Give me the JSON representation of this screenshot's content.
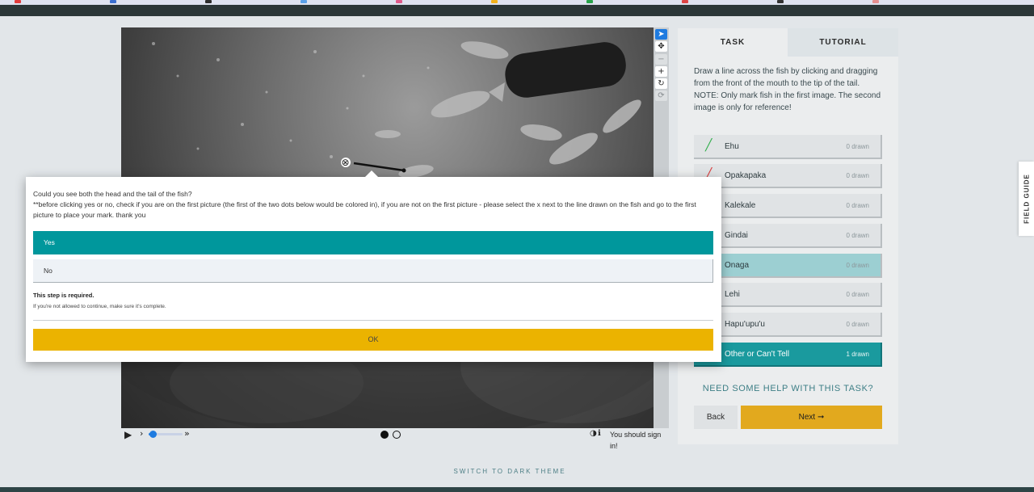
{
  "browser": {
    "favicon_colors": [
      "#e23b3b",
      "#3a6fd0",
      "#2d2d2d",
      "#5aa0e8",
      "#e05a8a",
      "#f3b21b",
      "#27a34a",
      "#d44",
      "#333",
      "#e58f8f"
    ]
  },
  "viewer": {
    "tools": [
      "pointer-icon",
      "move-icon",
      "zoom-out-icon",
      "zoom-in-icon",
      "rotate-icon",
      "reset-icon"
    ],
    "toolbar_glyphs": {
      "pointer": "➤",
      "move": "✥",
      "zoom_out": "−",
      "zoom_in": "+",
      "rotate": "↻",
      "reset": "⟳"
    },
    "delete_mark_glyph": "⊗",
    "playback": {
      "play_glyph": "▶",
      "step_back_glyph": "›",
      "step_forward_glyph": "»",
      "speed_level": 0.12,
      "frames": 2,
      "current_frame": 1
    },
    "contrast_glyph": "◑",
    "info_glyph": "ℹ",
    "signin_note": "You should sign in!"
  },
  "task_panel": {
    "tabs": [
      "TASK",
      "TUTORIAL"
    ],
    "active_tab": "TASK",
    "instructions": [
      "Draw a line across the fish by clicking and dragging from the front of the mouth to the tip of the tail.",
      "NOTE: Only mark fish in the first image. The second image is only for reference!"
    ],
    "tools": [
      {
        "label": "Ehu",
        "count": "0 drawn",
        "mark_color": "#2fae4a",
        "mark": "╱",
        "state": "normal"
      },
      {
        "label": "Opakapaka",
        "count": "0 drawn",
        "mark_color": "#d93b3b",
        "mark": "╱",
        "state": "normal"
      },
      {
        "label": "Kalekale",
        "count": "0 drawn",
        "mark_color": "",
        "mark": "",
        "state": "normal"
      },
      {
        "label": "Gindai",
        "count": "0 drawn",
        "mark_color": "",
        "mark": "",
        "state": "normal"
      },
      {
        "label": "Onaga",
        "count": "0 drawn",
        "mark_color": "",
        "mark": "",
        "state": "highlight"
      },
      {
        "label": "Lehi",
        "count": "0 drawn",
        "mark_color": "",
        "mark": "",
        "state": "normal"
      },
      {
        "label": "Hapu'upu'u",
        "count": "0 drawn",
        "mark_color": "",
        "mark": "",
        "state": "normal"
      },
      {
        "label": "Other or Can't Tell",
        "count": "1 drawn",
        "mark_color": "",
        "mark": "",
        "state": "active"
      }
    ],
    "help_link": "NEED SOME HELP WITH THIS TASK?",
    "back_label": "Back",
    "next_label": "Next ➞"
  },
  "field_guide": "FIELD GUIDE",
  "theme_toggle": "SWITCH TO DARK THEME",
  "modal": {
    "question_line1": "Could you see both the head and the tail of the fish?",
    "question_line2": "**before clicking yes or no, check if you are on the first picture (the first of the two dots below would be colored in), if you are not on the first picture - please select the x next to the line drawn on the fish and go to the first picture to place your mark. thank you",
    "answers": [
      "Yes",
      "No"
    ],
    "selected_answer": "Yes",
    "required_title": "This step is required.",
    "required_hint": "If you're not allowed to continue, make sure it's complete.",
    "ok_label": "OK"
  },
  "colors": {
    "teal": "#00979c",
    "gold": "#ebb300",
    "next_gold": "#e2a91e",
    "accent_blue": "#1e7be0"
  }
}
